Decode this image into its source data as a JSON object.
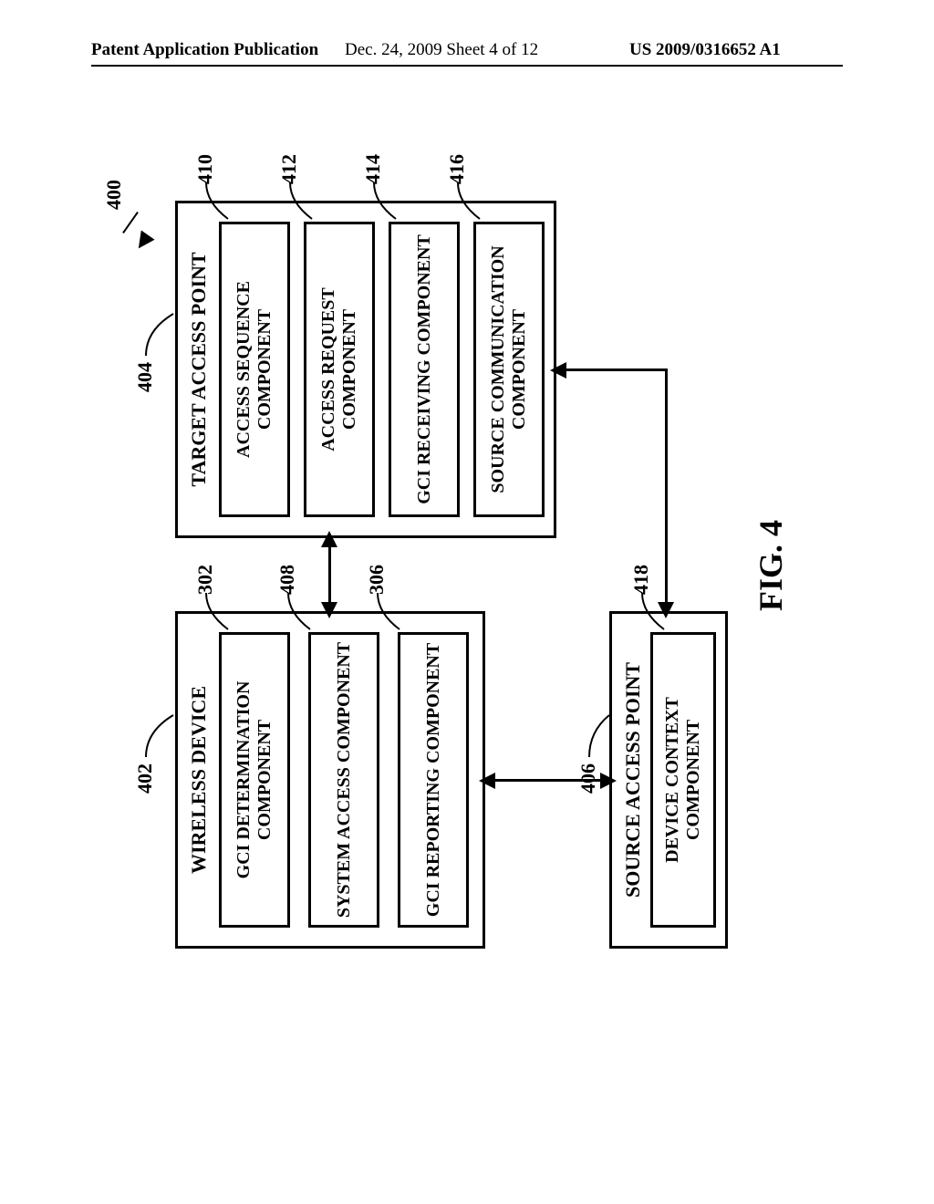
{
  "header": {
    "left": "Patent Application Publication",
    "mid": "Dec. 24, 2009   Sheet 4 of 12",
    "right": "US 2009/0316652 A1"
  },
  "figure_caption": "FIG. 4",
  "refs": {
    "r400": "400",
    "r402": "402",
    "r302": "302",
    "r408": "408",
    "r306": "306",
    "r404": "404",
    "r410": "410",
    "r412": "412",
    "r414": "414",
    "r416": "416",
    "r406": "406",
    "r418": "418"
  },
  "wireless": {
    "title": "WIRELESS DEVICE",
    "c1": "GCI DETERMINATION COMPONENT",
    "c2": "SYSTEM ACCESS COMPONENT",
    "c3": "GCI REPORTING COMPONENT"
  },
  "target": {
    "title": "TARGET ACCESS POINT",
    "c1": "ACCESS SEQUENCE COMPONENT",
    "c2": "ACCESS REQUEST COMPONENT",
    "c3": "GCI RECEIVING COMPONENT",
    "c4": "SOURCE COMMUNICATION COMPONENT"
  },
  "source": {
    "title": "SOURCE ACCESS POINT",
    "c1": "DEVICE CONTEXT COMPONENT"
  },
  "chart_data": {
    "type": "diagram",
    "title": "FIG. 4",
    "nodes": [
      {
        "id": "400",
        "label": "(system)",
        "ref": "400"
      },
      {
        "id": "402",
        "label": "WIRELESS DEVICE",
        "ref": "402",
        "children": [
          {
            "id": "302",
            "label": "GCI DETERMINATION COMPONENT"
          },
          {
            "id": "408",
            "label": "SYSTEM ACCESS COMPONENT"
          },
          {
            "id": "306",
            "label": "GCI REPORTING COMPONENT"
          }
        ]
      },
      {
        "id": "404",
        "label": "TARGET ACCESS POINT",
        "ref": "404",
        "children": [
          {
            "id": "410",
            "label": "ACCESS SEQUENCE COMPONENT"
          },
          {
            "id": "412",
            "label": "ACCESS REQUEST COMPONENT"
          },
          {
            "id": "414",
            "label": "GCI RECEIVING COMPONENT"
          },
          {
            "id": "416",
            "label": "SOURCE COMMUNICATION COMPONENT"
          }
        ]
      },
      {
        "id": "406",
        "label": "SOURCE ACCESS POINT",
        "ref": "406",
        "children": [
          {
            "id": "418",
            "label": "DEVICE CONTEXT COMPONENT"
          }
        ]
      }
    ],
    "edges": [
      {
        "from": "402",
        "to": "404",
        "bidirectional": true
      },
      {
        "from": "402",
        "to": "406",
        "bidirectional": true
      },
      {
        "from": "404",
        "to": "406",
        "bidirectional": true
      }
    ]
  }
}
